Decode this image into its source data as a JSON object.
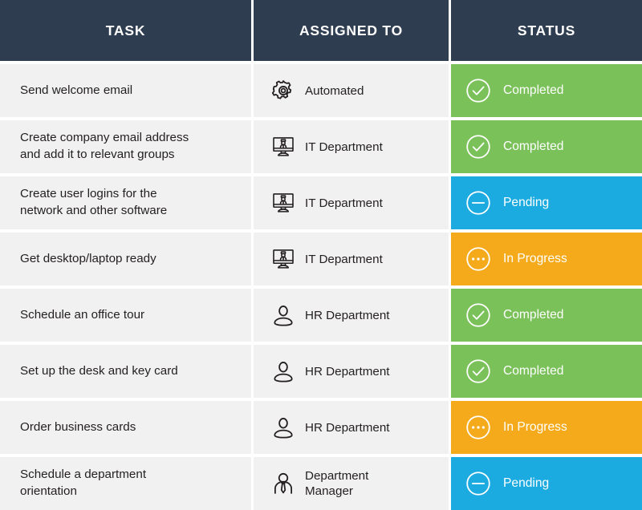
{
  "table": {
    "columns": [
      {
        "key": "task",
        "label": "TASK"
      },
      {
        "key": "assigned_to",
        "label": "ASSIGNED TO"
      },
      {
        "key": "status",
        "label": "STATUS"
      }
    ],
    "colors": {
      "header_bg": "#2E3E50",
      "cell_bg": "#F1F1F1",
      "completed": "#7AC15A",
      "pending": "#1BABE0",
      "in_progress": "#F4AA1A",
      "text": "#231F20",
      "status_text": "#FFFFFF"
    },
    "rows": [
      {
        "task_line1": "Send welcome email",
        "task_line2": "",
        "assigned_to_line1": "Automated",
        "assigned_to_line2": "",
        "assigned_icon": "gear-icon",
        "status": "Completed",
        "status_icon": "check-circle-icon",
        "status_color": "#7AC15A"
      },
      {
        "task_line1": "Create company email address",
        "task_line2": "and add it to relevant groups",
        "assigned_to_line1": "IT Department",
        "assigned_to_line2": "",
        "assigned_icon": "monitor-user-icon",
        "status": "Completed",
        "status_icon": "check-circle-icon",
        "status_color": "#7AC15A"
      },
      {
        "task_line1": "Create user logins for the",
        "task_line2": "network and other software",
        "assigned_to_line1": "IT Department",
        "assigned_to_line2": "",
        "assigned_icon": "monitor-user-icon",
        "status": "Pending",
        "status_icon": "minus-circle-icon",
        "status_color": "#1BABE0"
      },
      {
        "task_line1": "Get desktop/laptop ready",
        "task_line2": "",
        "assigned_to_line1": "IT Department",
        "assigned_to_line2": "",
        "assigned_icon": "monitor-user-icon",
        "status": "In Progress",
        "status_icon": "dots-circle-icon",
        "status_color": "#F4AA1A"
      },
      {
        "task_line1": "Schedule an office tour",
        "task_line2": "",
        "assigned_to_line1": "HR Department",
        "assigned_to_line2": "",
        "assigned_icon": "person-icon",
        "status": "Completed",
        "status_icon": "check-circle-icon",
        "status_color": "#7AC15A"
      },
      {
        "task_line1": "Set up the desk and key card",
        "task_line2": "",
        "assigned_to_line1": "HR Department",
        "assigned_to_line2": "",
        "assigned_icon": "person-icon",
        "status": "Completed",
        "status_icon": "check-circle-icon",
        "status_color": "#7AC15A"
      },
      {
        "task_line1": "Order business cards",
        "task_line2": "",
        "assigned_to_line1": "HR Department",
        "assigned_to_line2": "",
        "assigned_icon": "person-icon",
        "status": "In Progress",
        "status_icon": "dots-circle-icon",
        "status_color": "#F4AA1A"
      },
      {
        "task_line1": "Schedule a department",
        "task_line2": "orientation",
        "assigned_to_line1": "Department",
        "assigned_to_line2": "Manager",
        "assigned_icon": "manager-icon",
        "status": "Pending",
        "status_icon": "minus-circle-icon",
        "status_color": "#1BABE0"
      }
    ]
  }
}
